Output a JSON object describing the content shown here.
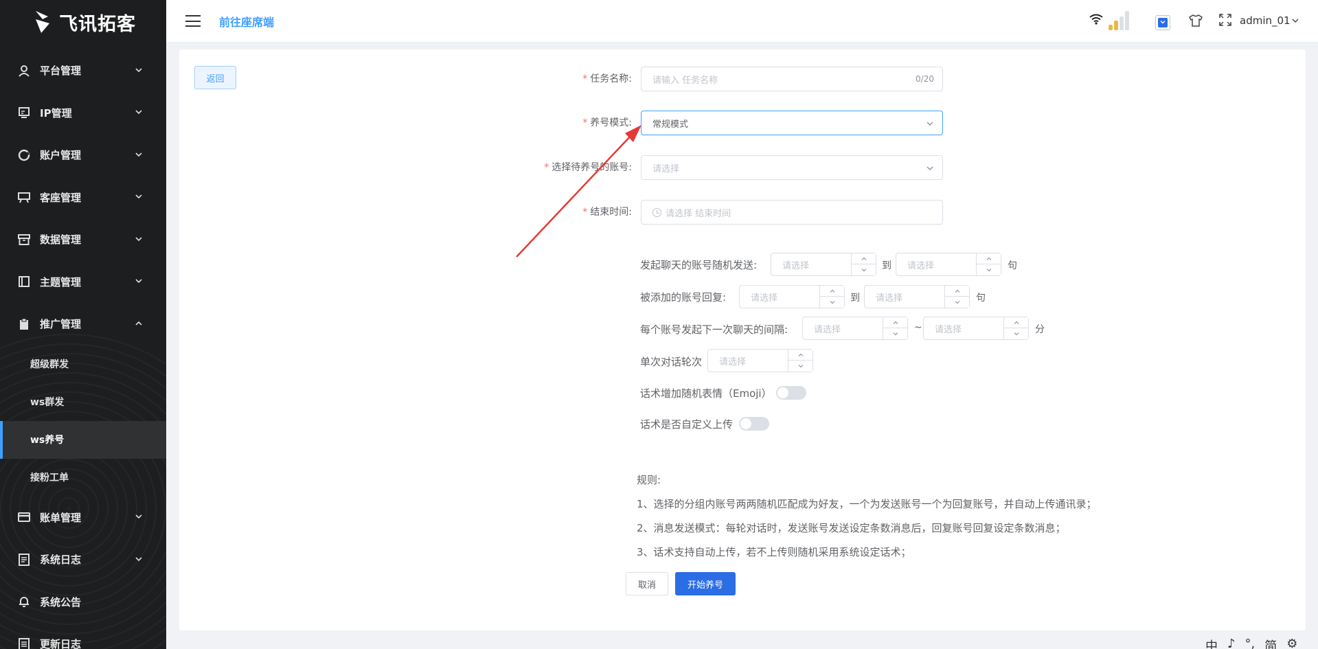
{
  "brand": {
    "name": "飞讯拓客"
  },
  "sidebar": {
    "items": [
      {
        "label": "平台管理",
        "icon": "user-icon"
      },
      {
        "label": "IP管理",
        "icon": "monitor-icon"
      },
      {
        "label": "账户管理",
        "icon": "account-icon"
      },
      {
        "label": "客座管理",
        "icon": "screen-icon"
      },
      {
        "label": "数据管理",
        "icon": "archive-icon"
      },
      {
        "label": "主题管理",
        "icon": "book-icon"
      },
      {
        "label": "推广管理",
        "icon": "clipboard-icon",
        "expanded": true
      }
    ],
    "sub_items": [
      {
        "label": "超级群发"
      },
      {
        "label": "ws群发"
      },
      {
        "label": "ws养号",
        "active": true
      },
      {
        "label": "接粉工单"
      }
    ],
    "items_after": [
      {
        "label": "账单管理",
        "icon": "card-icon"
      },
      {
        "label": "系统日志",
        "icon": "log-icon"
      },
      {
        "label": "系统公告",
        "icon": "bell-icon"
      },
      {
        "label": "更新日志",
        "icon": "doc-icon"
      }
    ]
  },
  "header": {
    "link": "前往座席端",
    "username": "admin_01",
    "colors": {
      "accent": "#409eff",
      "primary_button": "#2b6de5"
    }
  },
  "form": {
    "back_label": "返回",
    "task_name": {
      "label": "任务名称:",
      "placeholder": "请输入 任务名称",
      "count": "0/20"
    },
    "mode": {
      "label": "养号模式:",
      "value": "常规模式"
    },
    "accounts": {
      "label": "选择待养号的账号:",
      "placeholder": "请选择"
    },
    "end_time": {
      "label": "结束时间:",
      "placeholder": "请选择 结束时间"
    },
    "chat_send": {
      "label": "发起聊天的账号随机发送:",
      "from": "请选择",
      "to_text": "到",
      "to": "请选择",
      "unit": "句"
    },
    "reply": {
      "label": "被添加的账号回复:",
      "from": "请选择",
      "to_text": "到",
      "to": "请选择",
      "unit": "句"
    },
    "interval": {
      "label": "每个账号发起下一次聊天的间隔:",
      "from": "请选择",
      "to_text": "~",
      "to": "请选择",
      "unit": "分"
    },
    "rounds": {
      "label": "单次对话轮次",
      "value": "请选择"
    },
    "emoji": {
      "label": "话术增加随机表情（Emoji）",
      "on": false
    },
    "custom_upload": {
      "label": "话术是否自定义上传",
      "on": false
    }
  },
  "rules": {
    "title": "规则:",
    "lines": [
      "1、选择的分组内账号两两随机匹配成为好友，一个为发送账号一个为回复账号，并自动上传通讯录；",
      "2、消息发送模式：每轮对话时，发送账号发送设定条数消息后，回复账号回复设定条数消息；",
      "3、话术支持自动上传，若不上传则随机采用系统设定话术；"
    ]
  },
  "actions": {
    "cancel": "取消",
    "submit": "开始养号"
  },
  "ime": [
    "中",
    "♪",
    "°,",
    "简",
    "⚙"
  ]
}
